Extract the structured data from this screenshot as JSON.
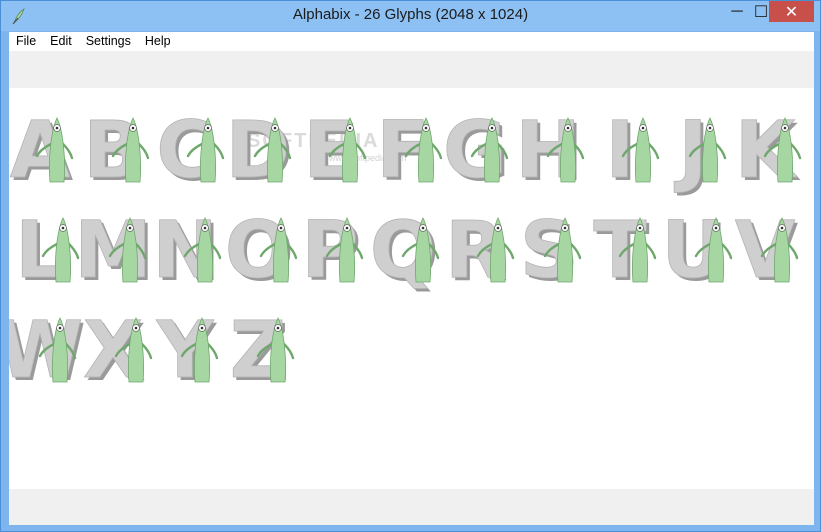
{
  "window": {
    "title": "Alphabix - 26 Glyphs (2048 x 1024)",
    "icon": "feather-app-icon",
    "controls": {
      "minimize": "─",
      "maximize": "☐",
      "close": "✕"
    }
  },
  "menu": [
    "File",
    "Edit",
    "Settings",
    "Help"
  ],
  "watermark": {
    "text": "SOFTPEDIA",
    "sub": "www.softpedia.com"
  },
  "glyphs": [
    "A",
    "B",
    "C",
    "D",
    "E",
    "F",
    "G",
    "H",
    "I",
    "J",
    "K",
    "L",
    "M",
    "N",
    "O",
    "P",
    "Q",
    "R",
    "S",
    "T",
    "U",
    "V",
    "W",
    "X",
    "Y",
    "Z"
  ],
  "colors": {
    "letter": "#cfcfcf",
    "letter_shadow": "#9a9a9a",
    "creature": "#a6d6a2",
    "creature_dark": "#6fa86c"
  }
}
